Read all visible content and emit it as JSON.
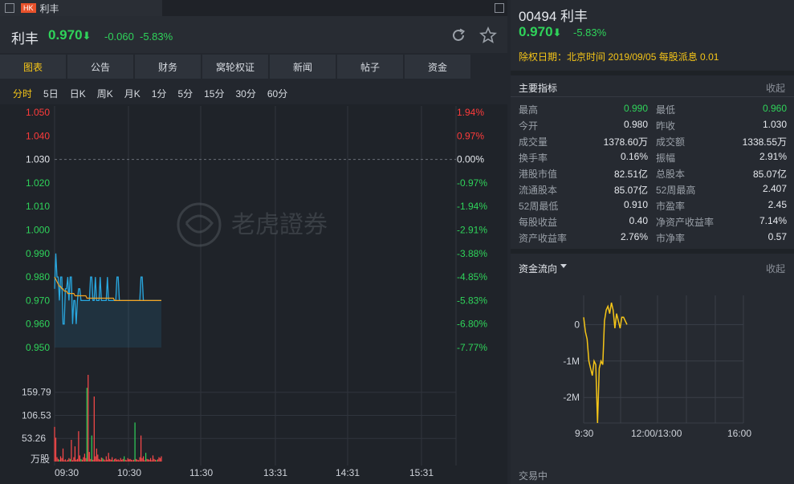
{
  "window": {
    "tab_title": "利丰",
    "market_badge": "HK"
  },
  "quote": {
    "name": "利丰",
    "price": "0.970",
    "change": "-0.060",
    "change_pct": "-5.83%",
    "arrow": "⬇"
  },
  "tabs": [
    "图表",
    "公告",
    "财务",
    "窝轮权证",
    "新闻",
    "帖子",
    "资金"
  ],
  "periods": [
    "分时",
    "5日",
    "日K",
    "周K",
    "月K",
    "1分",
    "5分",
    "15分",
    "30分",
    "60分"
  ],
  "watermark": "老虎證券",
  "right": {
    "code_name": "00494 利丰",
    "price": "0.970",
    "pct": "-5.83%",
    "dividend": "除权日期：北京时间 2019/09/05 每股派息 0.01",
    "indicators_title": "主要指标",
    "collapse": "收起",
    "indicators": [
      [
        "最高",
        "0.990",
        "最低",
        "0.960"
      ],
      [
        "今开",
        "0.980",
        "昨收",
        "1.030"
      ],
      [
        "成交量",
        "1378.60万",
        "成交额",
        "1338.55万"
      ],
      [
        "换手率",
        "0.16%",
        "振幅",
        "2.91%"
      ],
      [
        "港股市值",
        "82.51亿",
        "总股本",
        "85.07亿"
      ],
      [
        "流通股本",
        "85.07亿",
        "52周最高",
        "2.407"
      ],
      [
        "52周最低",
        "0.910",
        "市盈率",
        "2.45"
      ],
      [
        "每股收益",
        "0.40",
        "净资产收益率",
        "7.14%"
      ],
      [
        "资产收益率",
        "2.76%",
        "市净率",
        "0.57"
      ]
    ],
    "flow_title": "资金流向",
    "status": "交易中"
  },
  "colors": {
    "up": "#ff3b3b",
    "down": "#2fd35a",
    "flat": "#e6e9ee",
    "accent": "#f5c518",
    "price_line": "#29a8e0",
    "avg_line": "#f5a623"
  },
  "chart_data": [
    {
      "type": "line",
      "title": "",
      "x_ticks": [
        "09:30",
        "10:30",
        "11:30",
        "13:31",
        "14:31",
        "15:31"
      ],
      "y_ticks": [
        "1.050",
        "1.040",
        "1.030",
        "1.020",
        "1.010",
        "1.000",
        "0.990",
        "0.980",
        "0.970",
        "0.960",
        "0.950"
      ],
      "y_ticks_right": [
        "1.94%",
        "0.97%",
        "0.00%",
        "-0.97%",
        "-1.94%",
        "-2.91%",
        "-3.88%",
        "-4.85%",
        "-5.83%",
        "-6.80%",
        "-7.77%"
      ],
      "ylim": [
        0.95,
        1.05
      ],
      "prev_close": 1.03,
      "series": [
        {
          "name": "",
          "values": [
            0.975,
            0.99,
            0.98,
            0.98,
            0.97,
            0.98,
            0.98,
            0.96,
            0.96,
            0.975,
            0.975,
            0.98,
            0.97,
            0.98,
            0.98,
            0.96,
            0.97,
            0.97,
            0.96,
            0.97,
            0.975,
            0.975,
            0.97,
            0.97,
            0.97,
            0.97,
            0.97,
            0.97,
            0.97,
            0.97,
            0.98,
            0.98,
            0.97,
            0.97,
            0.98,
            0.97,
            0.97,
            0.97,
            0.98,
            0.97,
            0.97,
            0.97,
            0.97,
            0.97,
            0.98,
            0.97,
            0.97,
            0.97,
            0.97,
            0.97,
            0.97,
            0.97,
            0.98,
            0.98,
            0.97,
            0.97,
            0.97,
            0.97,
            0.97,
            0.97,
            0.97,
            0.97,
            0.97,
            0.97,
            0.97,
            0.97,
            0.97,
            0.97,
            0.97,
            0.97,
            0.97,
            0.97,
            0.98,
            0.98,
            0.97,
            0.97,
            0.97,
            0.97,
            0.97,
            0.97,
            0.97,
            0.97,
            0.97,
            0.97,
            0.97,
            0.97,
            0.97,
            0.97,
            0.97,
            0.97
          ]
        },
        {
          "name": "",
          "values": [
            0.98,
            0.979,
            0.978,
            0.977,
            0.976,
            0.976,
            0.975,
            0.975,
            0.974,
            0.974,
            0.974,
            0.973,
            0.973,
            0.973,
            0.973,
            0.973,
            0.973,
            0.972,
            0.972,
            0.972,
            0.972,
            0.972,
            0.972,
            0.972,
            0.972,
            0.972,
            0.972,
            0.971,
            0.971,
            0.971,
            0.971,
            0.971,
            0.971,
            0.971,
            0.971,
            0.971,
            0.971,
            0.971,
            0.971,
            0.971,
            0.971,
            0.971,
            0.971,
            0.971,
            0.971,
            0.971,
            0.971,
            0.971,
            0.971,
            0.971,
            0.97,
            0.97,
            0.97,
            0.97,
            0.97,
            0.97,
            0.97,
            0.97,
            0.97,
            0.97,
            0.97,
            0.97,
            0.97,
            0.97,
            0.97,
            0.97,
            0.97,
            0.97,
            0.97,
            0.97,
            0.97,
            0.97,
            0.97,
            0.97,
            0.97,
            0.97,
            0.97,
            0.97,
            0.97,
            0.97,
            0.97,
            0.97,
            0.97,
            0.97,
            0.97,
            0.97,
            0.97,
            0.97,
            0.97,
            0.97
          ]
        }
      ]
    },
    {
      "type": "bar",
      "title": "",
      "ylabel": "万股",
      "y_ticks": [
        "159.79",
        "106.53",
        "53.26"
      ],
      "ylim": [
        0,
        213
      ],
      "values": [
        80,
        55,
        10,
        6,
        4,
        12,
        8,
        30,
        3,
        5,
        2,
        4,
        8,
        6,
        50,
        3,
        10,
        35,
        4,
        6,
        70,
        14,
        6,
        4,
        10,
        18,
        8,
        170,
        200,
        22,
        6,
        60,
        4,
        150,
        12,
        30,
        16,
        6,
        4,
        9,
        8,
        5,
        3,
        12,
        4,
        20,
        6,
        4,
        10,
        3,
        6,
        7,
        4,
        5,
        3,
        8,
        4,
        6,
        12,
        4,
        3,
        8,
        5,
        6,
        4,
        3,
        4,
        90,
        6,
        4,
        3,
        10,
        60,
        8,
        12,
        3,
        20,
        6,
        5,
        4,
        8,
        3,
        14,
        6,
        4,
        3,
        5,
        10,
        8,
        12
      ]
    },
    {
      "type": "line",
      "title": "",
      "x_ticks": [
        "9:30",
        "12:00/13:00",
        "16:00"
      ],
      "y_ticks": [
        "0",
        "-1M",
        "-2M"
      ],
      "ylim": [
        -2.7,
        0.8
      ],
      "values": [
        0.2,
        -0.2,
        -0.4,
        -1.0,
        -1.2,
        -1.4,
        -1.0,
        -1.1,
        -2.7,
        -1.2,
        -1.0,
        -1.1,
        0.1,
        0.4,
        0.5,
        0.3,
        0.6,
        0.4,
        -0.1,
        0.3,
        0.1,
        -0.1,
        0.2,
        0.2,
        0.1,
        0.0
      ]
    }
  ]
}
